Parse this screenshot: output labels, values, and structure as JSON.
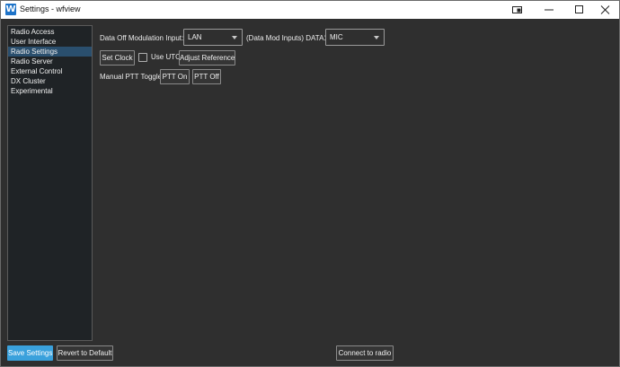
{
  "window": {
    "title": "Settings - wfview",
    "logo_letter": "W"
  },
  "sidebar": {
    "items": [
      {
        "label": "Radio Access",
        "active": false
      },
      {
        "label": "User Interface",
        "active": false
      },
      {
        "label": "Radio Settings",
        "active": true
      },
      {
        "label": "Radio Server",
        "active": false
      },
      {
        "label": "External Control",
        "active": false
      },
      {
        "label": "DX Cluster",
        "active": false
      },
      {
        "label": "Experimental",
        "active": false
      }
    ]
  },
  "radio_settings": {
    "data_off_label": "Data Off Modulation Input:",
    "data_off_value": "LAN",
    "data_mod_label": "(Data Mod Inputs)  DATA1:",
    "data1_value": "MIC",
    "set_clock_label": "Set Clock",
    "use_utc_label": "Use UTC",
    "use_utc_checked": false,
    "adjust_reference_label": "Adjust Reference",
    "manual_ptt_label": "Manual PTT Toggle",
    "ptt_on_label": "PTT On",
    "ptt_off_label": "PTT Off"
  },
  "footer": {
    "save_label": "Save Settings",
    "revert_label": "Revert to Default",
    "connect_label": "Connect to radio"
  },
  "colors": {
    "accent": "#3aa1dc",
    "selection": "#2a4f6e",
    "background": "#2f2f2f"
  }
}
